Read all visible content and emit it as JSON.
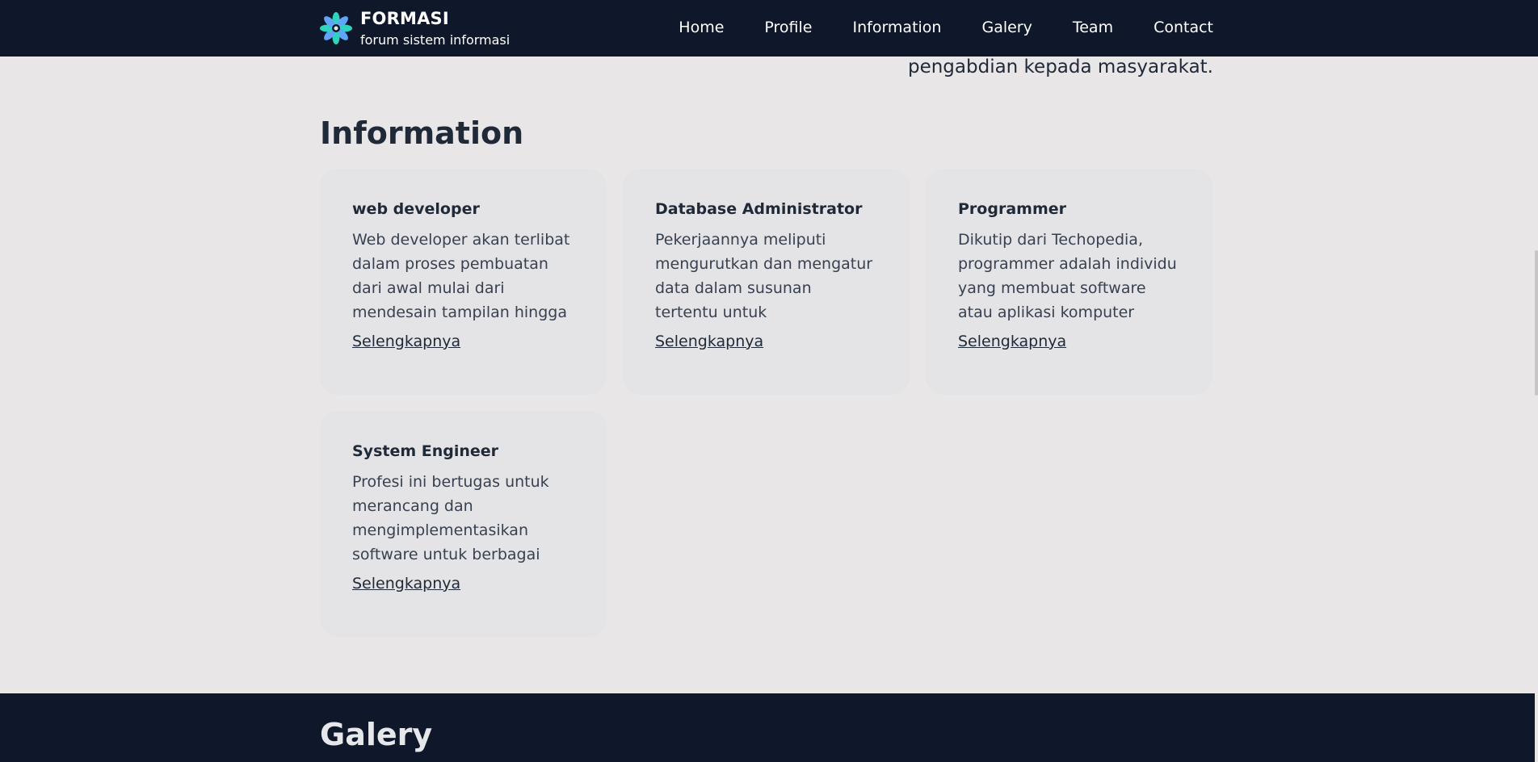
{
  "brand": {
    "title": "FORMASI",
    "subtitle": "forum sistem informasi",
    "logo_icon": "flower-logo-icon",
    "logo_colors": [
      "#2dd4bf",
      "#60a5fa"
    ]
  },
  "nav": {
    "items": [
      {
        "label": "Home"
      },
      {
        "label": "Profile"
      },
      {
        "label": "Information"
      },
      {
        "label": "Galery"
      },
      {
        "label": "Team"
      },
      {
        "label": "Contact"
      }
    ]
  },
  "intro": {
    "tail_text": "pengabdian kepada masyarakat."
  },
  "information": {
    "title": "Information",
    "cards": [
      {
        "title": "web developer",
        "body": "Web developer akan terlibat dalam proses pembuatan dari awal mulai dari mendesain tampilan hingga",
        "link": "Selengkapnya"
      },
      {
        "title": "Database Administrator",
        "body": "Pekerjaannya meliputi mengurutkan dan mengatur data dalam susunan tertentu untuk memudahkan",
        "link": "Selengkapnya"
      },
      {
        "title": "Programmer",
        "body": "Dikutip dari Techopedia, programmer adalah individu yang membuat software atau aplikasi komputer",
        "link": "Selengkapnya"
      },
      {
        "title": "System Engineer",
        "body": "Profesi ini bertugas untuk merancang dan mengimplementasikan software untuk berbagai",
        "link": "Selengkapnya"
      }
    ]
  },
  "galery": {
    "title": "Galery"
  },
  "colors": {
    "nav_bg": "#0f172a",
    "page_bg": "#e8e6e7",
    "card_bg": "#e4e4e6",
    "text_dark": "#1f2937"
  }
}
